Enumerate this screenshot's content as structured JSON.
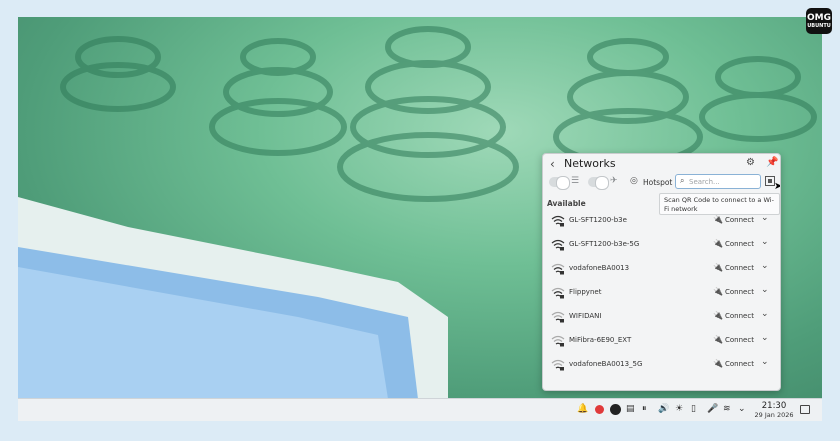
{
  "popup": {
    "title": "Networks",
    "hotspot_label": "Hotspot",
    "search_placeholder": "Search...",
    "tooltip": "Scan QR Code to connect to a Wi-Fi network",
    "section_label": "Available",
    "networks": [
      {
        "name": "GL-SFT1200-b3e",
        "action": "Connect",
        "signal": "strong"
      },
      {
        "name": "GL-SFT1200-b3e-5G",
        "action": "Connect",
        "signal": "strong"
      },
      {
        "name": "vodafoneBA0013",
        "action": "Connect",
        "signal": "medium"
      },
      {
        "name": "Flippynet",
        "action": "Connect",
        "signal": "medium"
      },
      {
        "name": "WIFIDANI",
        "action": "Connect",
        "signal": "weak"
      },
      {
        "name": "MiFibra-6E90_EXT",
        "action": "Connect",
        "signal": "weak"
      },
      {
        "name": "vodafoneBA0013_5G",
        "action": "Connect",
        "signal": "weak"
      }
    ]
  },
  "taskbar": {
    "time": "21:30",
    "date": "29 Jan 2026"
  },
  "logo": {
    "text": "OMG",
    "subtext": "UBUNTU"
  },
  "colors": {
    "accent": "#3d8fd6",
    "record": "#e03a3a"
  }
}
